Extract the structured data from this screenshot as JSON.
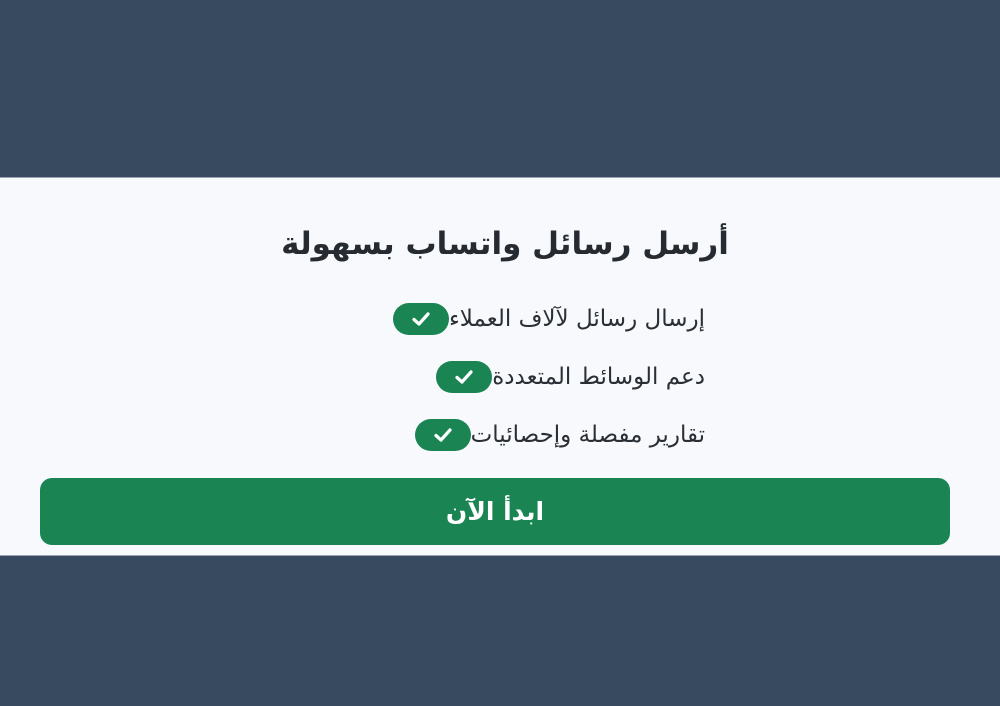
{
  "card": {
    "title": "أرسل رسائل واتساب بسهولة",
    "features": [
      {
        "label": "إرسال رسائل لآلاف العملاء",
        "icon": "check-icon"
      },
      {
        "label": "دعم الوسائط المتعددة",
        "icon": "check-icon"
      },
      {
        "label": "تقارير مفصلة وإحصائيات",
        "icon": "check-icon"
      }
    ],
    "cta_label": "ابدأ الآن"
  },
  "colors": {
    "page_background": "#374a5f",
    "card_background": "#f7f9fc",
    "accent_green": "#1a8553",
    "text_dark": "#262b31"
  }
}
